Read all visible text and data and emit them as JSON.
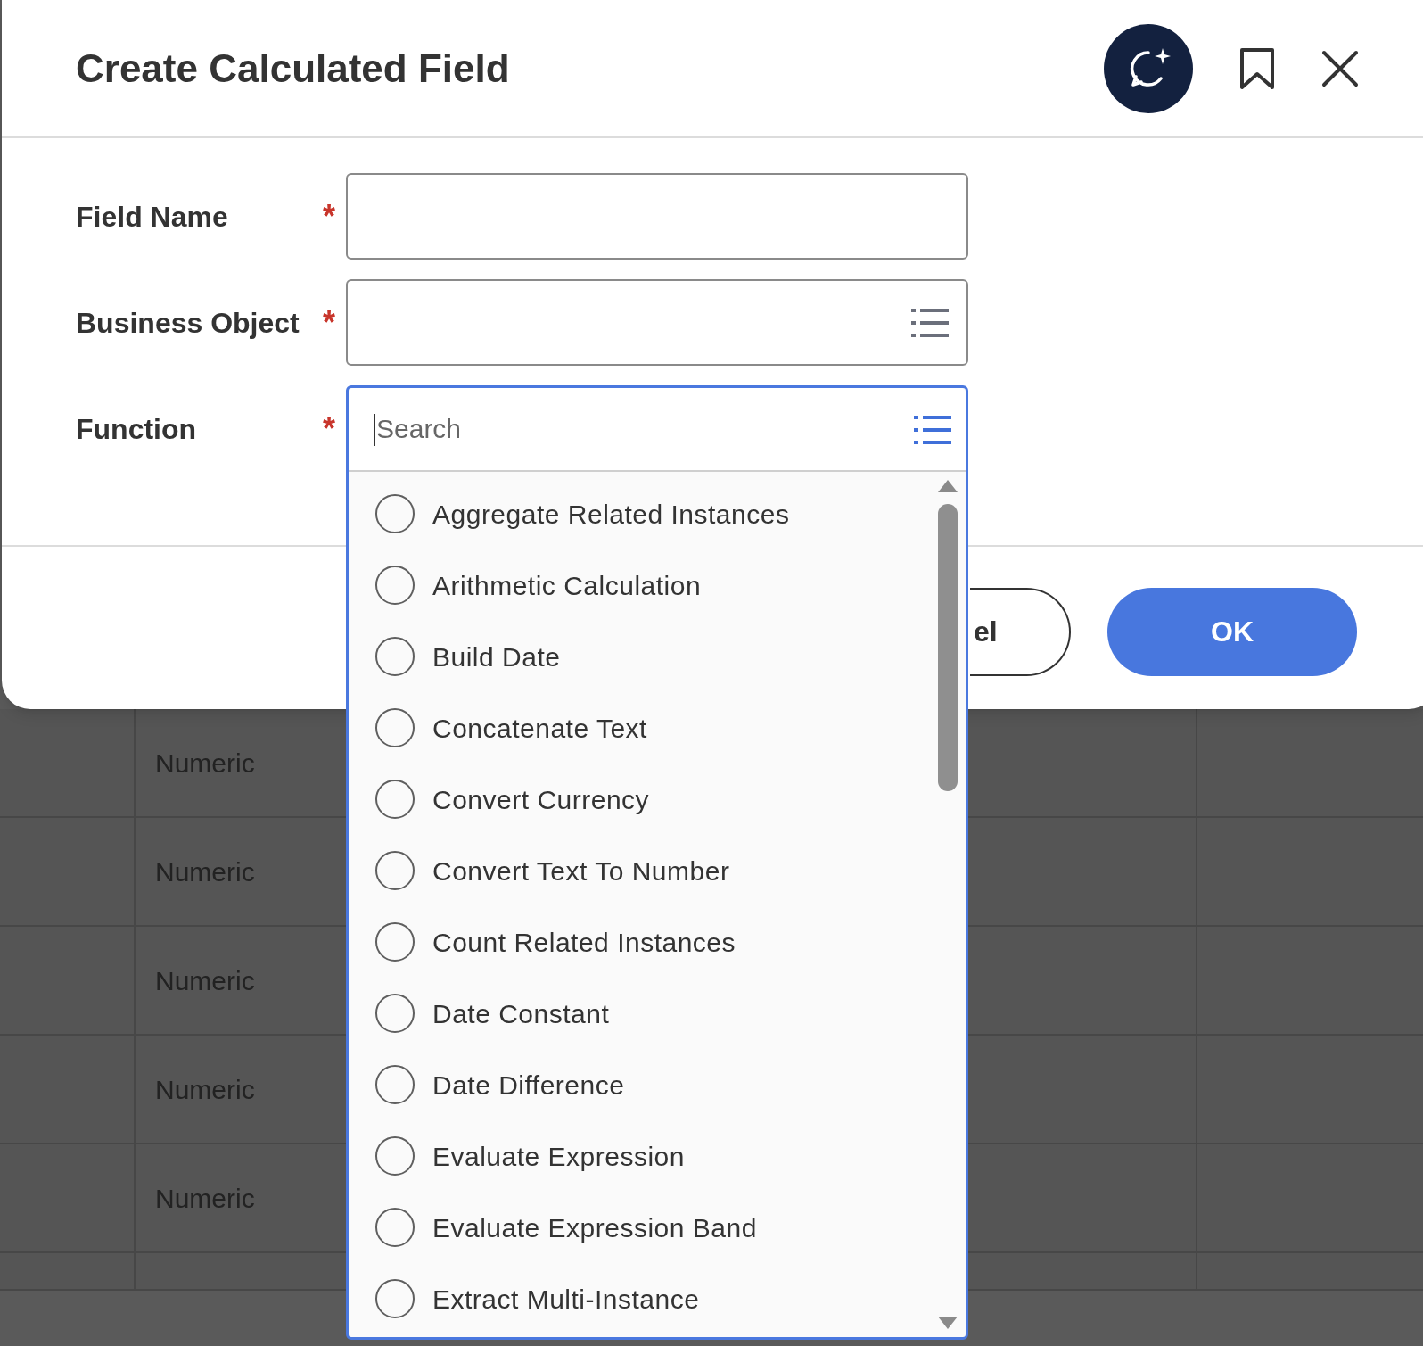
{
  "dialog": {
    "title": "Create Calculated Field",
    "fields": [
      {
        "label": "Field Name",
        "required_mark": "*",
        "kind": "text"
      },
      {
        "label": "Business Object",
        "required_mark": "*",
        "kind": "prompt"
      },
      {
        "label": "Function",
        "required_mark": "*",
        "kind": "dropdown"
      }
    ],
    "buttons": [
      {
        "label": "el",
        "kind": "secondary"
      },
      {
        "label": "OK",
        "kind": "primary"
      }
    ]
  },
  "function_dropdown": {
    "placeholder": "Search",
    "options": [
      {
        "label": "Aggregate Related Instances",
        "selected": false
      },
      {
        "label": "Arithmetic Calculation",
        "selected": false
      },
      {
        "label": "Build Date",
        "selected": false
      },
      {
        "label": "Concatenate Text",
        "selected": false
      },
      {
        "label": "Convert Currency",
        "selected": false
      },
      {
        "label": "Convert Text To Number",
        "selected": false
      },
      {
        "label": "Count Related Instances",
        "selected": false
      },
      {
        "label": "Date Constant",
        "selected": false
      },
      {
        "label": "Date Difference",
        "selected": false
      },
      {
        "label": "Evaluate Expression",
        "selected": false
      },
      {
        "label": "Evaluate Expression Band",
        "selected": false
      },
      {
        "label": "Extract Multi-Instance",
        "selected": false
      }
    ]
  },
  "background_table": {
    "rows": [
      {
        "column_2": "Numeric"
      },
      {
        "column_2": "Numeric"
      },
      {
        "column_2": "Numeric"
      },
      {
        "column_2": "Numeric"
      },
      {
        "column_2": "Numeric"
      }
    ]
  }
}
